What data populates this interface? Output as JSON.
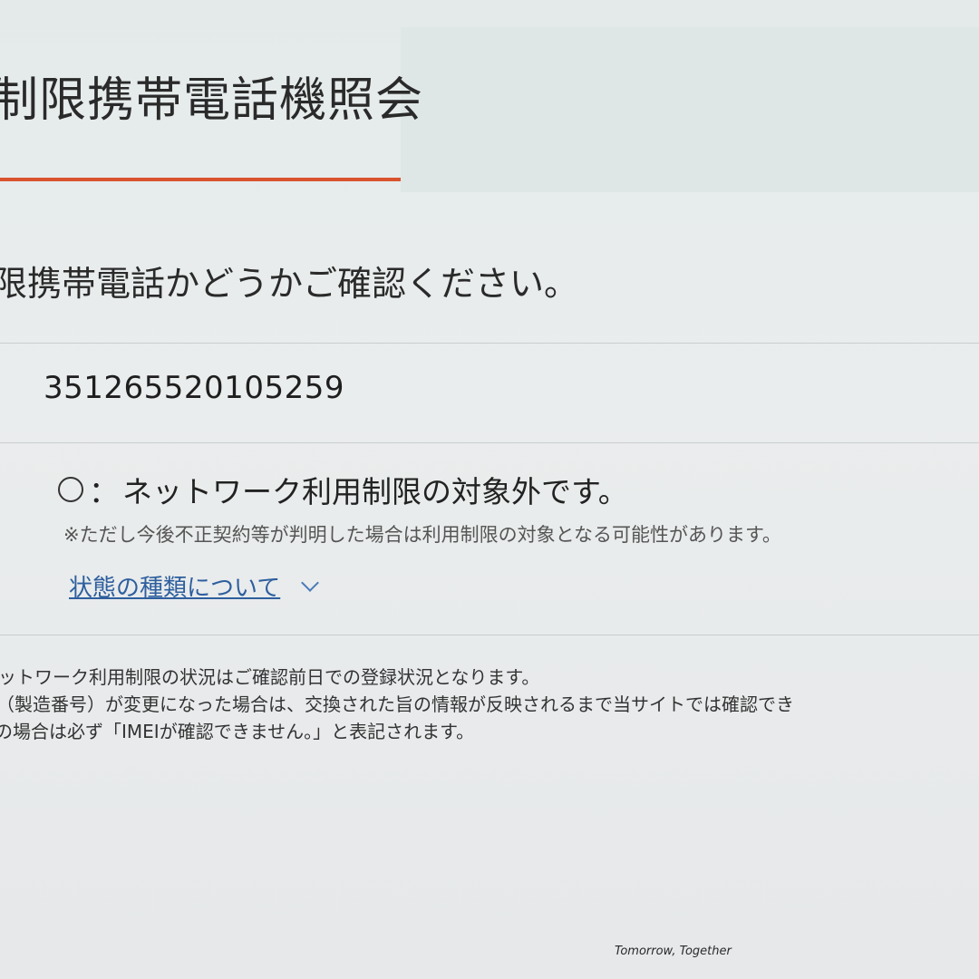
{
  "header": {
    "title": "制限携帯電話機照会"
  },
  "main": {
    "instruction": "限携帯電話かどうかご確認ください。",
    "imei_value": "351265520105259",
    "result": {
      "mark": "○",
      "separator": "：",
      "text": "ネットワーク利用制限の対象外です。",
      "note": "※ただし今後不正契約等が判明した場合は利用制限の対象となる可能性があります。"
    },
    "status_link": "状態の種類について"
  },
  "footnotes": [
    "ットワーク利用制限の状況はご確認前日での登録状況となります。",
    "（製造番号）が変更になった場合は、交換された旨の情報が反映されるまで当サイトでは確認でき",
    "の場合は必ず「IMEIが確認できません。」と表記されます。"
  ],
  "footer": {
    "slogan": "Tomorrow, Together"
  },
  "colors": {
    "accent_underline": "#d9532e",
    "link": "#2e5f9e"
  }
}
